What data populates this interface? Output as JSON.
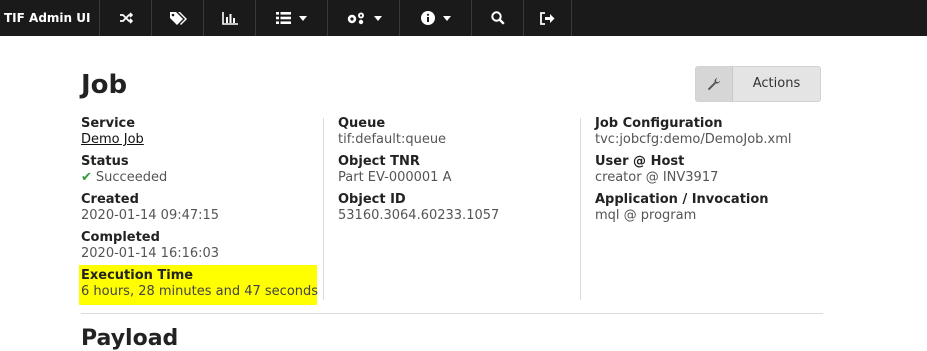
{
  "nav": {
    "brand": "TIF Admin UI",
    "items": [
      {
        "icon": "shuffle-icon"
      },
      {
        "icon": "tags-icon"
      },
      {
        "icon": "bar-chart-icon"
      },
      {
        "icon": "list-icon",
        "dropdown": true
      },
      {
        "icon": "cogs-icon",
        "dropdown": true
      },
      {
        "icon": "info-icon",
        "dropdown": true
      },
      {
        "icon": "search-icon"
      },
      {
        "icon": "sign-out-icon"
      }
    ]
  },
  "page": {
    "title": "Job",
    "actions_label": "Actions",
    "next_section_heading": "Payload"
  },
  "details": {
    "left": {
      "service_label": "Service",
      "service_value": "Demo Job",
      "status_label": "Status",
      "status_value": "Succeeded",
      "created_label": "Created",
      "created_value": "2020-01-14 09:47:15",
      "completed_label": "Completed",
      "completed_value": "2020-01-14 16:16:03",
      "exec_label": "Execution Time",
      "exec_value": "6 hours, 28 minutes and 47 seconds"
    },
    "middle": {
      "queue_label": "Queue",
      "queue_value": "tif:default:queue",
      "tnr_label": "Object TNR",
      "tnr_value": "Part EV-000001 A",
      "oid_label": "Object ID",
      "oid_value": "53160.3064.60233.1057"
    },
    "right": {
      "jobcfg_label": "Job Configuration",
      "jobcfg_value": "tvc:jobcfg:demo/DemoJob.xml",
      "userhost_label": "User @ Host",
      "userhost_value": "creator @ INV3917",
      "app_label": "Application / Invocation",
      "app_value": "mql @ program"
    }
  },
  "colors": {
    "nav_bg": "#1a1a1a",
    "highlight": "#ffff00",
    "success": "#2e9a3c"
  }
}
